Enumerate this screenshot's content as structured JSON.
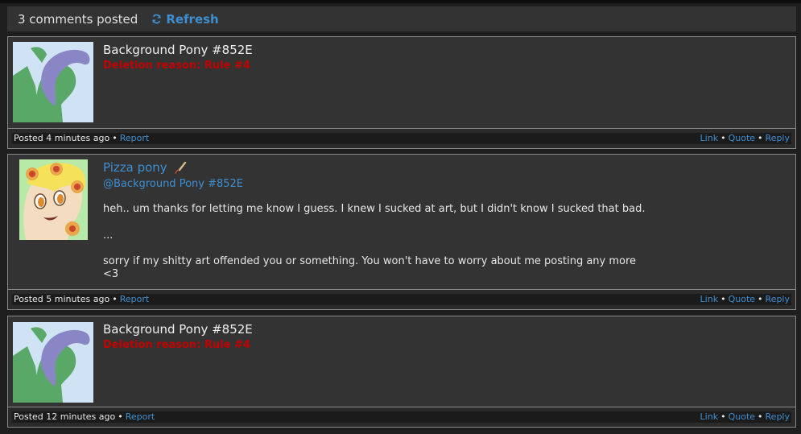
{
  "header": {
    "count_text": "3 comments posted",
    "refresh_label": "Refresh"
  },
  "comments": [
    {
      "author": "Background Pony #852E",
      "deletion_reason": "Deletion reason: Rule #4",
      "posted": "Posted 4 minutes ago",
      "report": "Report",
      "link": "Link",
      "quote": "Quote",
      "reply": "Reply"
    },
    {
      "author": "Pizza pony",
      "author_icon": "paintbrush-icon",
      "mention": "@Background Pony #852E",
      "para1": "heh.. um thanks for letting me know I guess. I knew I sucked at art, but I didn't know I sucked that bad.",
      "para2": "...",
      "para3": "sorry if my shitty art offended you or something. You won't have to worry about me posting any more\n<3",
      "posted": "Posted 5 minutes ago",
      "report": "Report",
      "link": "Link",
      "quote": "Quote",
      "reply": "Reply"
    },
    {
      "author": "Background Pony #852E",
      "deletion_reason": "Deletion reason: Rule #4",
      "posted": "Posted 12 minutes ago",
      "report": "Report",
      "link": "Link",
      "quote": "Quote",
      "reply": "Reply"
    }
  ],
  "colors": {
    "link": "#3d8fd1",
    "deletion": "#c20000",
    "panel": "#333333",
    "background": "#1e1e1e"
  }
}
